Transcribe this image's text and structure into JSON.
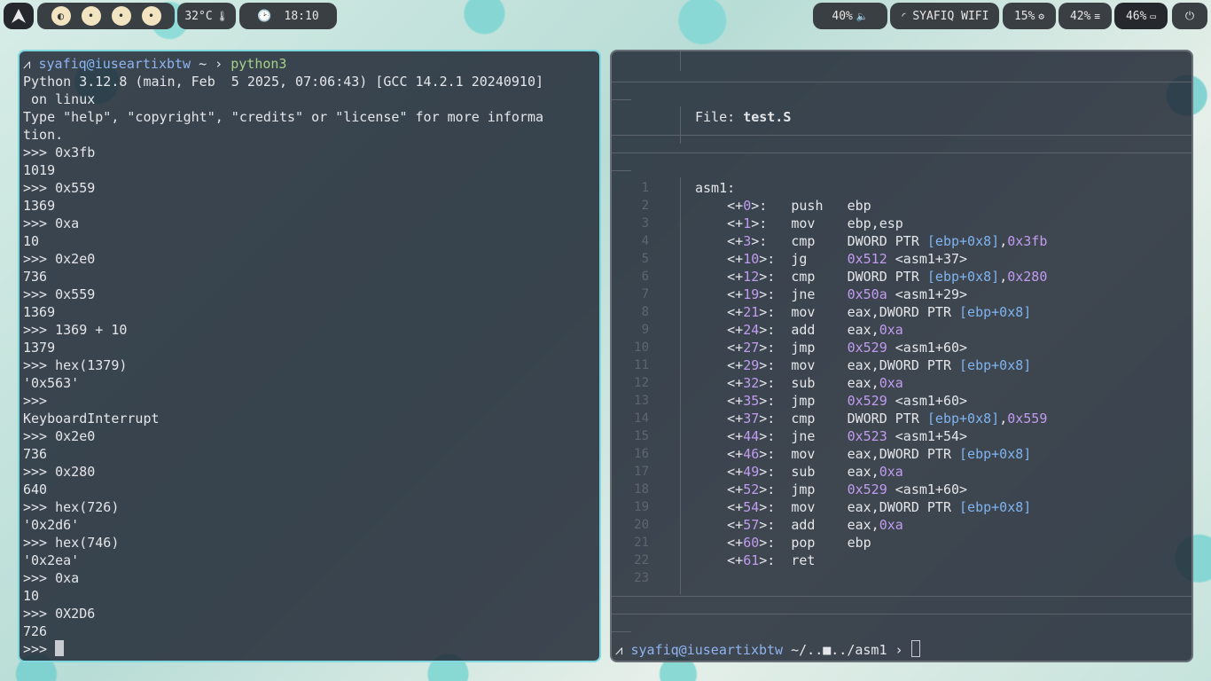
{
  "topbar": {
    "temperature": "32°C",
    "time": "18:10",
    "volume": "40%",
    "wifi": "SYAFIQ WIFI",
    "cpu": "15%",
    "memory": "42%",
    "battery": "46%"
  },
  "left_terminal": {
    "prompt_user": "syafiq@iuseartixbtw",
    "prompt_path": "~",
    "command": "python3",
    "lines": [
      "Python 3.12.8 (main, Feb  5 2025, 07:06:43) [GCC 14.2.1 20240910]",
      " on linux",
      "Type \"help\", \"copyright\", \"credits\" or \"license\" for more informa",
      "tion.",
      ">>> 0x3fb",
      "1019",
      ">>> 0x559",
      "1369",
      ">>> 0xa",
      "10",
      ">>> 0x2e0",
      "736",
      ">>> 0x559",
      "1369",
      ">>> 1369 + 10",
      "1379",
      ">>> hex(1379)",
      "'0x563'",
      ">>>",
      "KeyboardInterrupt",
      ">>> 0x2e0",
      "736",
      ">>> 0x280",
      "640",
      ">>> hex(726)",
      "'0x2d6'",
      ">>> hex(746)",
      "'0x2ea'",
      ">>> 0xa",
      "10",
      ">>> 0X2D6",
      "726"
    ],
    "input_prompt": ">>> "
  },
  "right_terminal": {
    "file_label": "File: ",
    "file_name": "test.S",
    "line_numbers": [
      "1",
      "2",
      "3",
      "4",
      "5",
      "6",
      "7",
      "8",
      "9",
      "10",
      "11",
      "12",
      "13",
      "14",
      "15",
      "16",
      "17",
      "18",
      "19",
      "20",
      "21",
      "22",
      "23"
    ],
    "code": [
      [
        {
          "t": "asm1:",
          "c": ""
        }
      ],
      [
        {
          "t": "    <+",
          "c": ""
        },
        {
          "t": "0",
          "c": "num"
        },
        {
          "t": ">:   push   ebp",
          "c": ""
        }
      ],
      [
        {
          "t": "    <+",
          "c": ""
        },
        {
          "t": "1",
          "c": "num"
        },
        {
          "t": ">:   mov    ebp,esp",
          "c": ""
        }
      ],
      [
        {
          "t": "    <+",
          "c": ""
        },
        {
          "t": "3",
          "c": "num"
        },
        {
          "t": ">:   cmp    DWORD PTR ",
          "c": ""
        },
        {
          "t": "[ebp+0x8]",
          "c": "reg"
        },
        {
          "t": ",",
          "c": ""
        },
        {
          "t": "0x3fb",
          "c": "num"
        }
      ],
      [
        {
          "t": "    <+",
          "c": ""
        },
        {
          "t": "10",
          "c": "num"
        },
        {
          "t": ">:  jg     ",
          "c": ""
        },
        {
          "t": "0x512",
          "c": "num"
        },
        {
          "t": " <asm1+37>",
          "c": ""
        }
      ],
      [
        {
          "t": "    <+",
          "c": ""
        },
        {
          "t": "12",
          "c": "num"
        },
        {
          "t": ">:  cmp    DWORD PTR ",
          "c": ""
        },
        {
          "t": "[ebp+0x8]",
          "c": "reg"
        },
        {
          "t": ",",
          "c": ""
        },
        {
          "t": "0x280",
          "c": "num"
        }
      ],
      [
        {
          "t": "    <+",
          "c": ""
        },
        {
          "t": "19",
          "c": "num"
        },
        {
          "t": ">:  jne    ",
          "c": ""
        },
        {
          "t": "0x50a",
          "c": "num"
        },
        {
          "t": " <asm1+29>",
          "c": ""
        }
      ],
      [
        {
          "t": "    <+",
          "c": ""
        },
        {
          "t": "21",
          "c": "num"
        },
        {
          "t": ">:  mov    eax,DWORD PTR ",
          "c": ""
        },
        {
          "t": "[ebp+0x8]",
          "c": "reg"
        }
      ],
      [
        {
          "t": "    <+",
          "c": ""
        },
        {
          "t": "24",
          "c": "num"
        },
        {
          "t": ">:  add    eax,",
          "c": ""
        },
        {
          "t": "0xa",
          "c": "num"
        }
      ],
      [
        {
          "t": "    <+",
          "c": ""
        },
        {
          "t": "27",
          "c": "num"
        },
        {
          "t": ">:  jmp    ",
          "c": ""
        },
        {
          "t": "0x529",
          "c": "num"
        },
        {
          "t": " <asm1+60>",
          "c": ""
        }
      ],
      [
        {
          "t": "    <+",
          "c": ""
        },
        {
          "t": "29",
          "c": "num"
        },
        {
          "t": ">:  mov    eax,DWORD PTR ",
          "c": ""
        },
        {
          "t": "[ebp+0x8]",
          "c": "reg"
        }
      ],
      [
        {
          "t": "    <+",
          "c": ""
        },
        {
          "t": "32",
          "c": "num"
        },
        {
          "t": ">:  sub    eax,",
          "c": ""
        },
        {
          "t": "0xa",
          "c": "num"
        }
      ],
      [
        {
          "t": "    <+",
          "c": ""
        },
        {
          "t": "35",
          "c": "num"
        },
        {
          "t": ">:  jmp    ",
          "c": ""
        },
        {
          "t": "0x529",
          "c": "num"
        },
        {
          "t": " <asm1+60>",
          "c": ""
        }
      ],
      [
        {
          "t": "    <+",
          "c": ""
        },
        {
          "t": "37",
          "c": "num"
        },
        {
          "t": ">:  cmp    DWORD PTR ",
          "c": ""
        },
        {
          "t": "[ebp+0x8]",
          "c": "reg"
        },
        {
          "t": ",",
          "c": ""
        },
        {
          "t": "0x559",
          "c": "num"
        }
      ],
      [
        {
          "t": "    <+",
          "c": ""
        },
        {
          "t": "44",
          "c": "num"
        },
        {
          "t": ">:  jne    ",
          "c": ""
        },
        {
          "t": "0x523",
          "c": "num"
        },
        {
          "t": " <asm1+54>",
          "c": ""
        }
      ],
      [
        {
          "t": "    <+",
          "c": ""
        },
        {
          "t": "46",
          "c": "num"
        },
        {
          "t": ">:  mov    eax,DWORD PTR ",
          "c": ""
        },
        {
          "t": "[ebp+0x8]",
          "c": "reg"
        }
      ],
      [
        {
          "t": "    <+",
          "c": ""
        },
        {
          "t": "49",
          "c": "num"
        },
        {
          "t": ">:  sub    eax,",
          "c": ""
        },
        {
          "t": "0xa",
          "c": "num"
        }
      ],
      [
        {
          "t": "    <+",
          "c": ""
        },
        {
          "t": "52",
          "c": "num"
        },
        {
          "t": ">:  jmp    ",
          "c": ""
        },
        {
          "t": "0x529",
          "c": "num"
        },
        {
          "t": " <asm1+60>",
          "c": ""
        }
      ],
      [
        {
          "t": "    <+",
          "c": ""
        },
        {
          "t": "54",
          "c": "num"
        },
        {
          "t": ">:  mov    eax,DWORD PTR ",
          "c": ""
        },
        {
          "t": "[ebp+0x8]",
          "c": "reg"
        }
      ],
      [
        {
          "t": "    <+",
          "c": ""
        },
        {
          "t": "57",
          "c": "num"
        },
        {
          "t": ">:  add    eax,",
          "c": ""
        },
        {
          "t": "0xa",
          "c": "num"
        }
      ],
      [
        {
          "t": "    <+",
          "c": ""
        },
        {
          "t": "60",
          "c": "num"
        },
        {
          "t": ">:  pop    ebp",
          "c": ""
        }
      ],
      [
        {
          "t": "    <+",
          "c": ""
        },
        {
          "t": "61",
          "c": "num"
        },
        {
          "t": ">:  ret",
          "c": ""
        }
      ],
      []
    ],
    "prompt_user": "syafiq@iuseartixbtw",
    "prompt_path": "~/..■../asm1",
    "prompt_arrow": "›"
  }
}
